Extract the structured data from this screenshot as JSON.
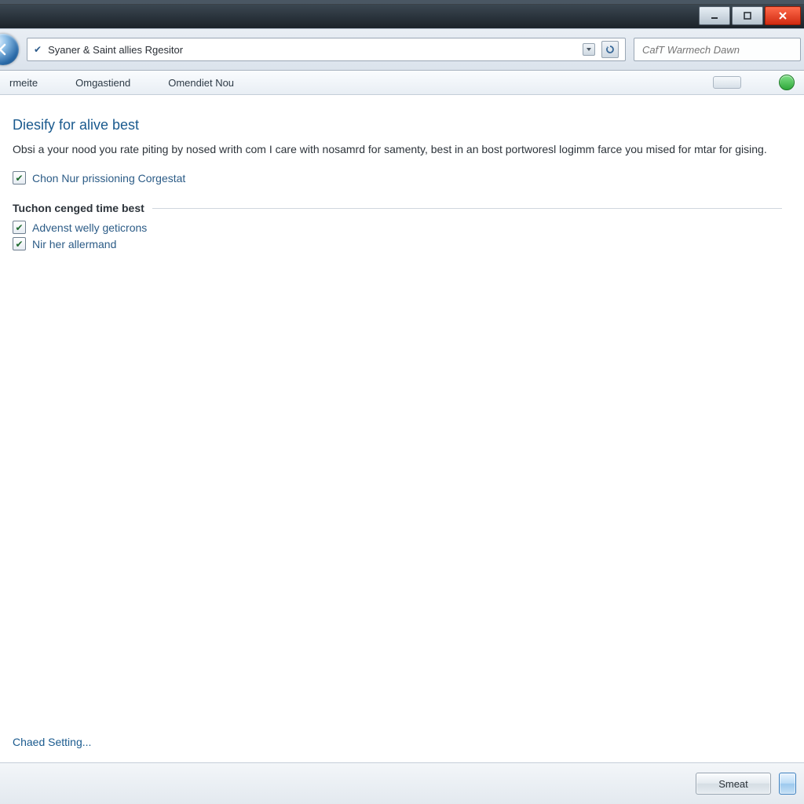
{
  "window": {
    "address_text": "Syaner & Saint allies Rgesitor",
    "search_placeholder": "CafT Warmech Dawn"
  },
  "toolbar": {
    "items": [
      "rmeite",
      "Omgastiend",
      "Omendiet Nou"
    ]
  },
  "page": {
    "heading": "Diesify for alive best",
    "description": "Obsi a your nood you rate piting by nosed writh com I care with nosamrd for samenty, best in an bost portworesl logimm farce you mised for mtar for gising.",
    "checkbox_top": "Chon Nur prissioning Corgestat",
    "fieldset_label": "Tuchon cenged time best",
    "option1": "Advenst welly geticrons",
    "option2": "Nir her allermand",
    "bottom_link": "Chaed Setting..."
  },
  "footer": {
    "primary_button": "Smeat"
  }
}
